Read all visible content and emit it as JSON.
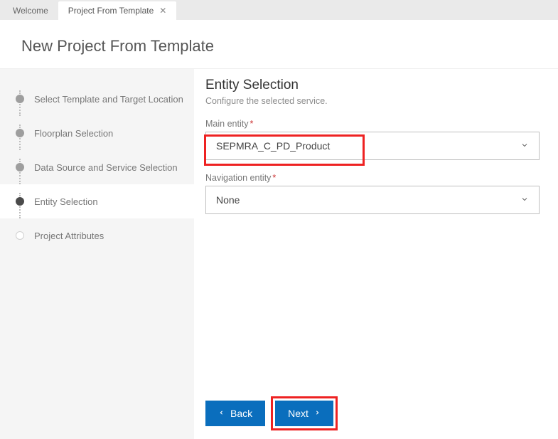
{
  "tabs": {
    "welcome": "Welcome",
    "project_from_template": "Project From Template"
  },
  "title": "New Project From Template",
  "steps": [
    {
      "label": "Select Template and Target Location",
      "state": "done"
    },
    {
      "label": "Floorplan Selection",
      "state": "done"
    },
    {
      "label": "Data Source and Service Selection",
      "state": "done"
    },
    {
      "label": "Entity Selection",
      "state": "active"
    },
    {
      "label": "Project Attributes",
      "state": "future"
    }
  ],
  "main": {
    "heading": "Entity Selection",
    "subheading": "Configure the selected service.",
    "main_entity_label": "Main entity",
    "main_entity_value": "SEPMRA_C_PD_Product",
    "nav_entity_label": "Navigation entity",
    "nav_entity_value": "None"
  },
  "buttons": {
    "back": "Back",
    "next": "Next"
  },
  "colors": {
    "primary": "#0a6ebd",
    "highlight": "#e22222"
  }
}
